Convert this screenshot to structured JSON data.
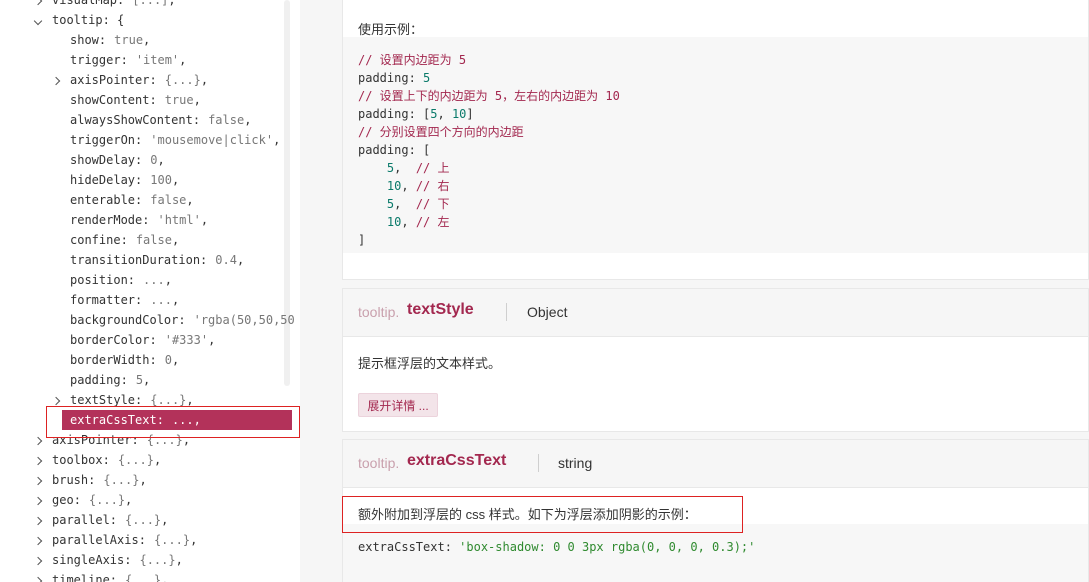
{
  "tree": {
    "rows": [
      {
        "key": "visualMap",
        "value": "[...]",
        "sep": ","
      },
      {
        "key": "tooltip",
        "value": "",
        "sep": " {"
      },
      {
        "key": "show",
        "value": "true",
        "sep": ","
      },
      {
        "key": "trigger",
        "value": "'item'",
        "sep": ","
      },
      {
        "key": "axisPointer",
        "value": "{...}",
        "sep": ","
      },
      {
        "key": "showContent",
        "value": "true",
        "sep": ","
      },
      {
        "key": "alwaysShowContent",
        "value": "false",
        "sep": ","
      },
      {
        "key": "triggerOn",
        "value": "'mousemove|click'",
        "sep": ","
      },
      {
        "key": "showDelay",
        "value": "0",
        "sep": ","
      },
      {
        "key": "hideDelay",
        "value": "100",
        "sep": ","
      },
      {
        "key": "enterable",
        "value": "false",
        "sep": ","
      },
      {
        "key": "renderMode",
        "value": "'html'",
        "sep": ","
      },
      {
        "key": "confine",
        "value": "false",
        "sep": ","
      },
      {
        "key": "transitionDuration",
        "value": "0.4",
        "sep": ","
      },
      {
        "key": "position",
        "value": "...",
        "sep": ","
      },
      {
        "key": "formatter",
        "value": "...",
        "sep": ","
      },
      {
        "key": "backgroundColor",
        "value": "'rgba(50,50,50",
        "sep": ""
      },
      {
        "key": "borderColor",
        "value": "'#333'",
        "sep": ","
      },
      {
        "key": "borderWidth",
        "value": "0",
        "sep": ","
      },
      {
        "key": "padding",
        "value": "5",
        "sep": ","
      },
      {
        "key": "textStyle",
        "value": "{...}",
        "sep": ","
      },
      {
        "key": "extraCssText",
        "value": "...",
        "sep": ","
      },
      {
        "key": "axisPointer",
        "value": "{...}",
        "sep": ","
      },
      {
        "key": "toolbox",
        "value": "{...}",
        "sep": ","
      },
      {
        "key": "brush",
        "value": "{...}",
        "sep": ","
      },
      {
        "key": "geo",
        "value": "{...}",
        "sep": ","
      },
      {
        "key": "parallel",
        "value": "{...}",
        "sep": ","
      },
      {
        "key": "parallelAxis",
        "value": "{...}",
        "sep": ","
      },
      {
        "key": "singleAxis",
        "value": "{...}",
        "sep": ","
      },
      {
        "key": "timeline",
        "value": "{...}",
        "sep": ","
      }
    ]
  },
  "padding_card": {
    "example_label": "使用示例：",
    "code": [
      "// 设置内边距为 5",
      "padding: 5",
      "// 设置上下的内边距为 5，左右的内边距为 10",
      "padding: [5, 10]",
      "// 分别设置四个方向的内边距",
      "padding: [",
      "    5,  // 上",
      "    10, // 右",
      "    5,  // 下",
      "    10, // 左",
      "]"
    ]
  },
  "text_style_card": {
    "prefix": "tooltip.",
    "name": "textStyle",
    "type": "Object",
    "description": "提示框浮层的文本样式。",
    "expand_label": "展开详情 ..."
  },
  "extra_css_card": {
    "prefix": "tooltip.",
    "name": "extraCssText",
    "type": "string",
    "description": "额外附加到浮层的 css 样式。如下为浮层添加阴影的示例：",
    "code_key": "extraCssText:",
    "code_value": "'box-shadow: 0 0 3px rgba(0, 0, 0, 0.3);'"
  },
  "colors": {
    "accent": "#a3284f",
    "selected_bg": "#b3325a",
    "highlight_border": "#dd2222"
  }
}
